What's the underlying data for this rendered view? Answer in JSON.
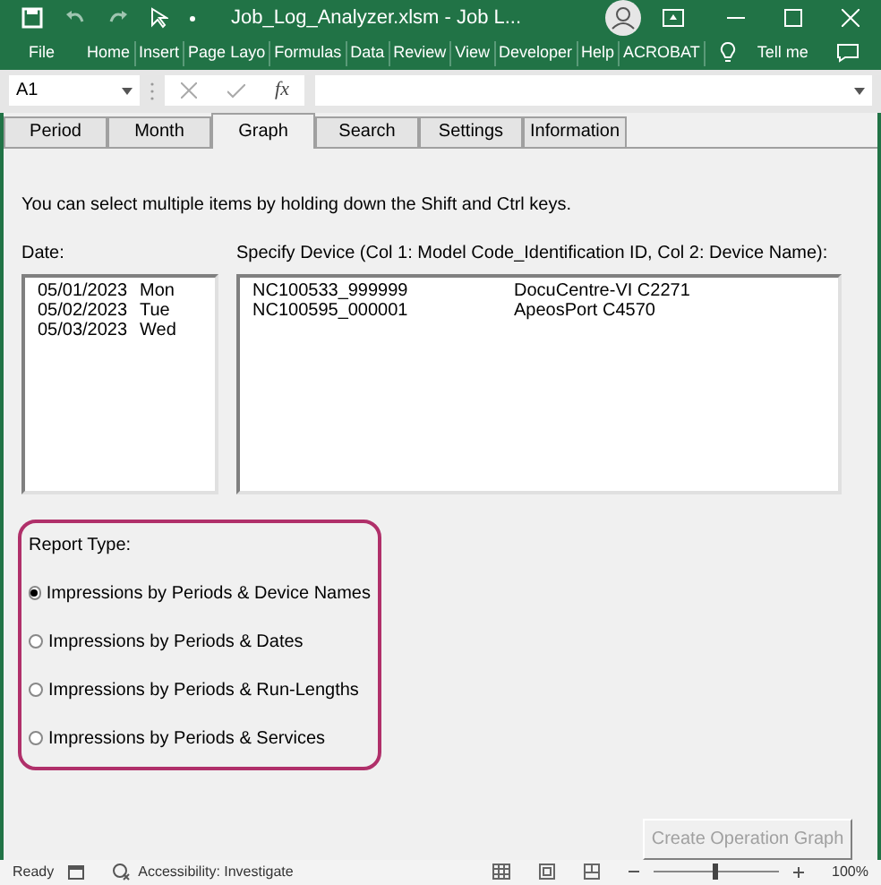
{
  "window": {
    "title": "Job_Log_Analyzer.xlsm  -  Job L..."
  },
  "ribbon_tabs": [
    {
      "label": "File"
    },
    {
      "label": "Home"
    },
    {
      "label": "Insert"
    },
    {
      "label": "Page Layo"
    },
    {
      "label": "Formulas"
    },
    {
      "label": "Data"
    },
    {
      "label": "Review"
    },
    {
      "label": "View"
    },
    {
      "label": "Developer"
    },
    {
      "label": "Help"
    },
    {
      "label": "ACROBAT"
    }
  ],
  "tell_me": "Tell me",
  "formula_bar": {
    "name_box": "A1",
    "fx": "fx"
  },
  "form_tabs": [
    {
      "label": "Period",
      "selected": false
    },
    {
      "label": "Month",
      "selected": false
    },
    {
      "label": "Graph",
      "selected": true
    },
    {
      "label": "Search",
      "selected": false
    },
    {
      "label": "Settings",
      "selected": false
    },
    {
      "label": "Information",
      "selected": false
    }
  ],
  "instruction": "You can select multiple items by holding down the Shift and Ctrl keys.",
  "date_list": {
    "label": "Date:",
    "items": [
      {
        "date": "05/01/2023",
        "day": "Mon"
      },
      {
        "date": "05/02/2023",
        "day": "Tue"
      },
      {
        "date": "05/03/2023",
        "day": "Wed"
      }
    ]
  },
  "device_list": {
    "label": "Specify Device (Col 1: Model Code_Identification ID, Col 2: Device Name):",
    "items": [
      {
        "id": "NC100533_999999",
        "name": "DocuCentre-VI C2271"
      },
      {
        "id": "NC100595_000001",
        "name": "ApeosPort C4570"
      }
    ]
  },
  "report_type": {
    "label": "Report Type:",
    "options": [
      {
        "label": "Impressions by Periods & Device Names",
        "selected": true
      },
      {
        "label": "Impressions by Periods & Dates",
        "selected": false
      },
      {
        "label": "Impressions by Periods & Run-Lengths",
        "selected": false
      },
      {
        "label": "Impressions by Periods & Services",
        "selected": false
      }
    ]
  },
  "create_button": {
    "label": "Create Operation Graph",
    "disabled": true
  },
  "status_bar": {
    "status": "Ready",
    "accessibility": "Accessibility: Investigate",
    "zoom": "100%",
    "zoom_slider": {
      "level": 0.5
    }
  }
}
